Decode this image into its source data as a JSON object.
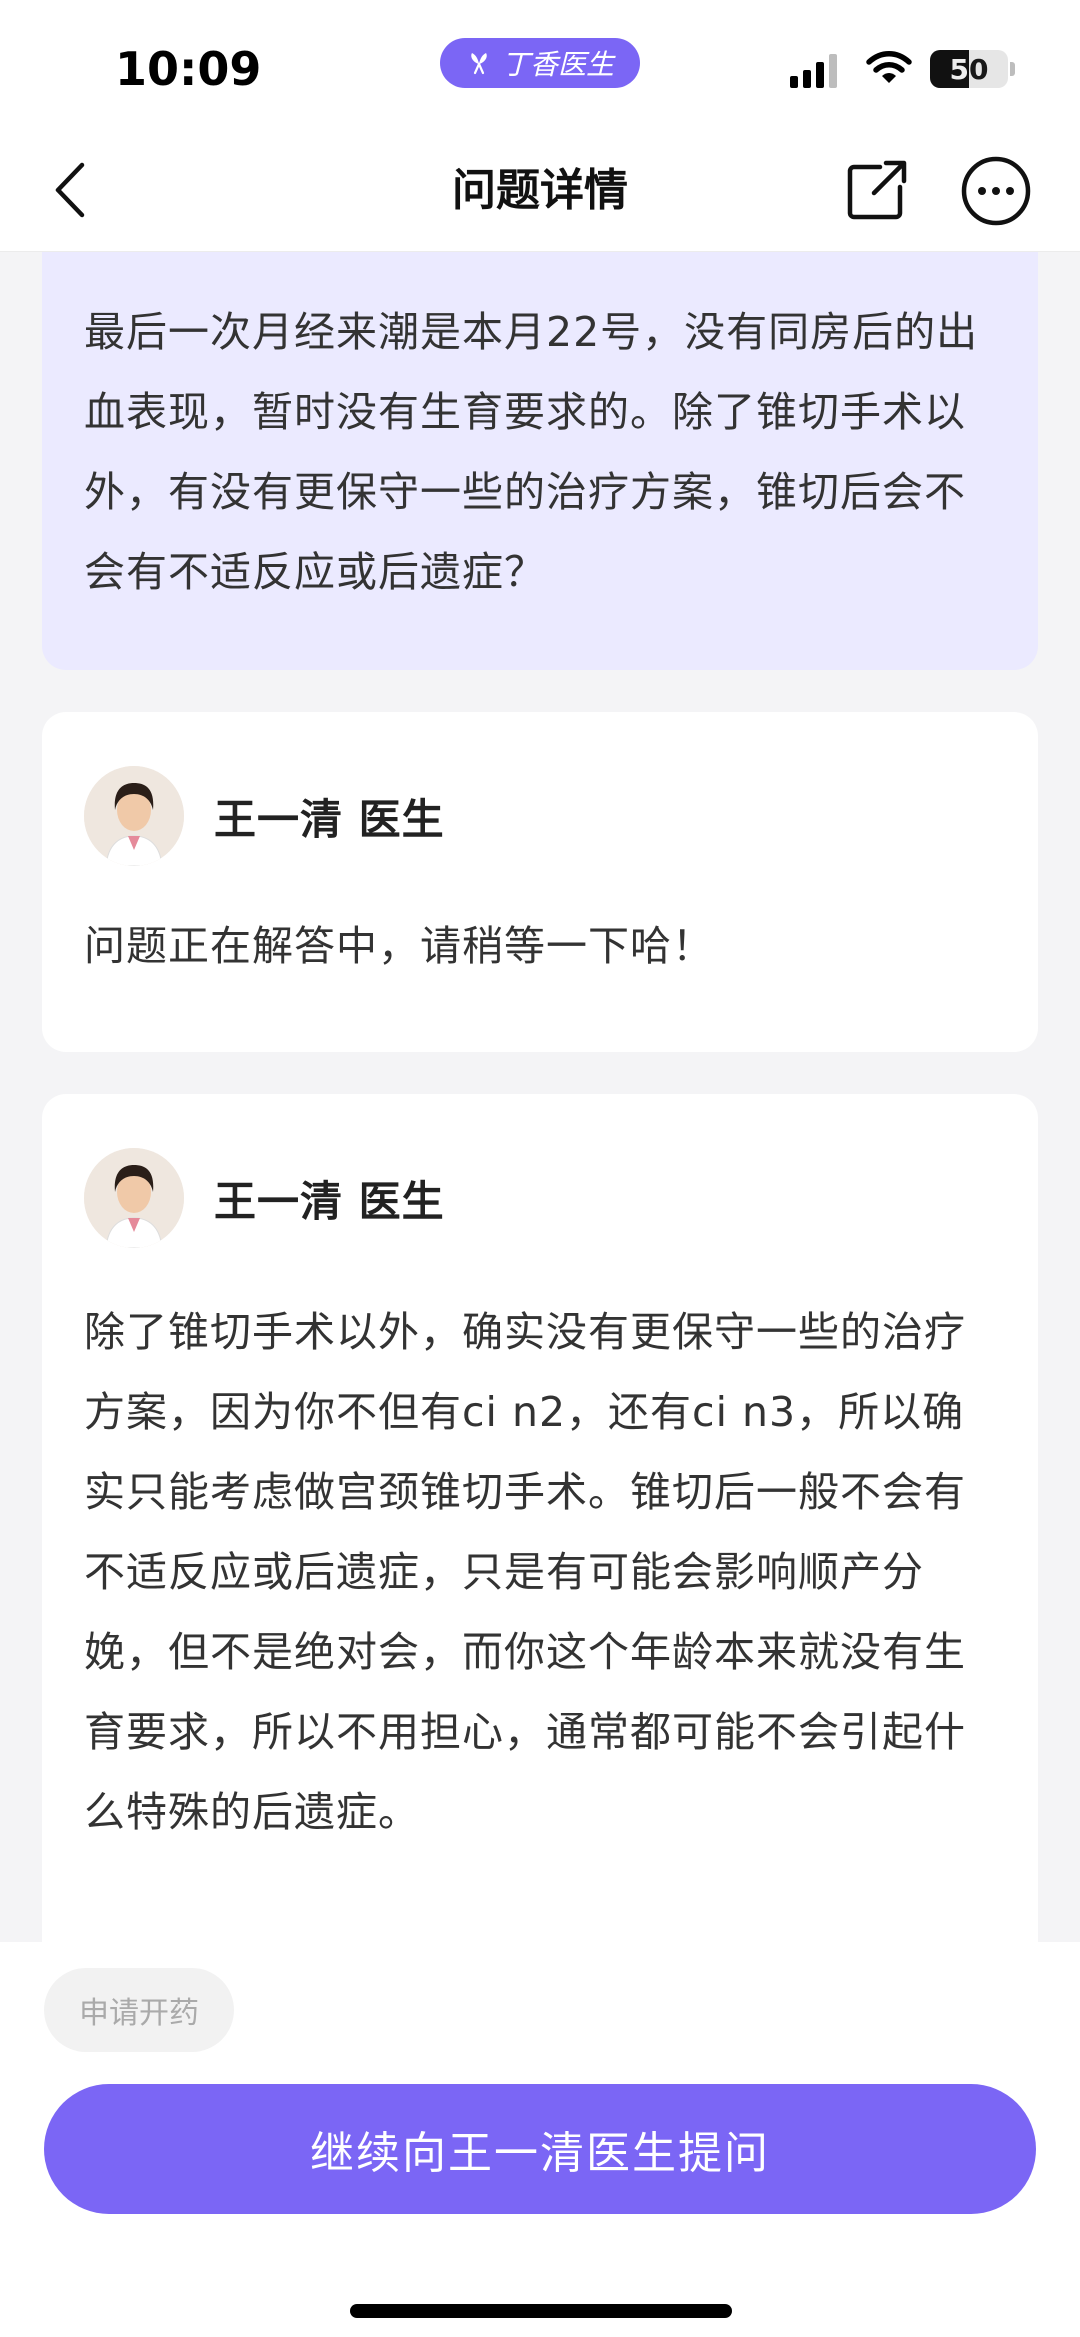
{
  "status_bar": {
    "time": "10:09",
    "app_badge": "丁香医生",
    "battery_level": "50",
    "battery_fraction": 0.5
  },
  "nav": {
    "title": "问题详情"
  },
  "question": {
    "text": "最后一次月经来潮是本月22号，没有同房后的出血表现，暂时没有生育要求的。除了锥切手术以外，有没有更保守一些的治疗方案，锥切后会不会有不适反应或后遗症？"
  },
  "answers": [
    {
      "doctor": "王一清 医生",
      "text": "问题正在解答中，请稍等一下哈！"
    },
    {
      "doctor": "王一清 医生",
      "text": "除了锥切手术以外，确实没有更保守一些的治疗方案，因为你不但有ci n2，还有ci n3，所以确实只能考虑做宫颈锥切手术。锥切后一般不会有不适反应或后遗症，只是有可能会影响顺产分娩，但不是绝对会，而你这个年龄本来就没有生育要求，所以不用担心，通常都可能不会引起什么特殊的后遗症。"
    }
  ],
  "bottom": {
    "chip_label": "申请开药",
    "cta_label": "继续向王一清医生提问"
  },
  "colors": {
    "accent": "#7b66f5",
    "question_bg": "#ebeaff",
    "page_bg": "#f4f4f6"
  },
  "icons": {
    "back": "chevron-left-icon",
    "share": "share-icon",
    "more": "more-icon"
  }
}
